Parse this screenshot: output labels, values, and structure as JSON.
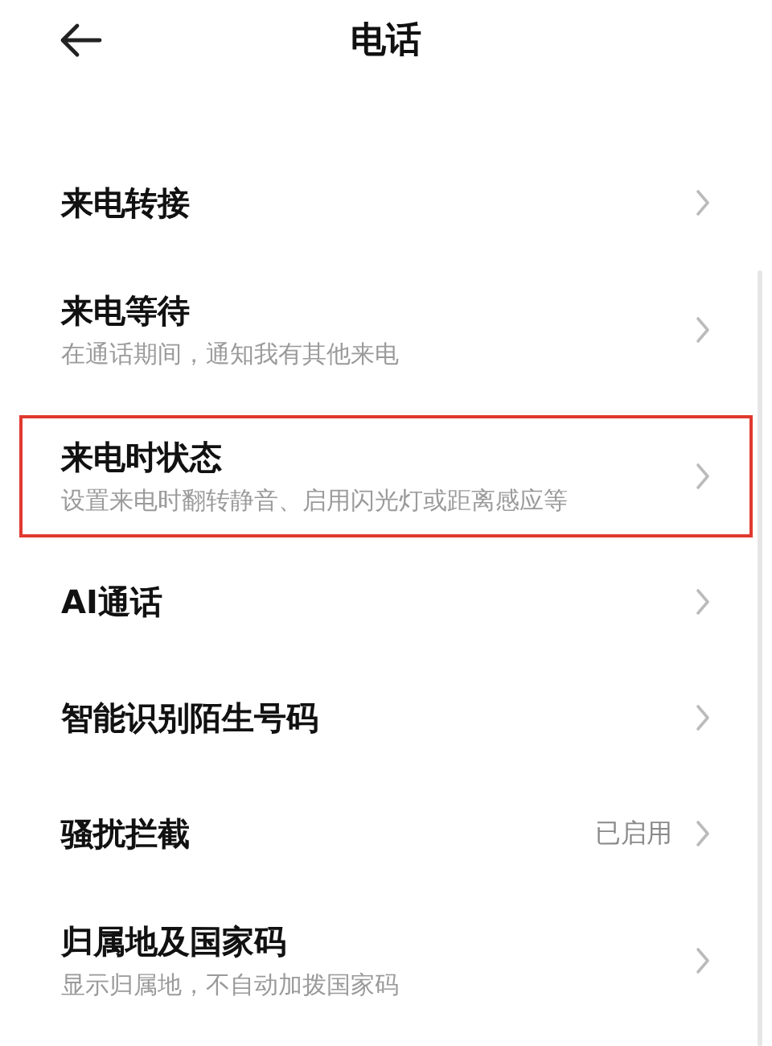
{
  "header": {
    "title": "电话"
  },
  "items": [
    {
      "title": "来电转接",
      "highlighted": false
    },
    {
      "title": "来电等待",
      "subtitle": "在通话期间，通知我有其他来电",
      "highlighted": false
    },
    {
      "title": "来电时状态",
      "subtitle": "设置来电时翻转静音、启用闪光灯或距离感应等",
      "highlighted": true
    },
    {
      "title": "AI通话",
      "highlighted": false
    },
    {
      "title": "智能识别陌生号码",
      "highlighted": false
    },
    {
      "title": "骚扰拦截",
      "value": "已启用",
      "highlighted": false
    },
    {
      "title": "归属地及国家码",
      "subtitle": "显示归属地，不自动加拨国家码",
      "highlighted": false
    }
  ]
}
